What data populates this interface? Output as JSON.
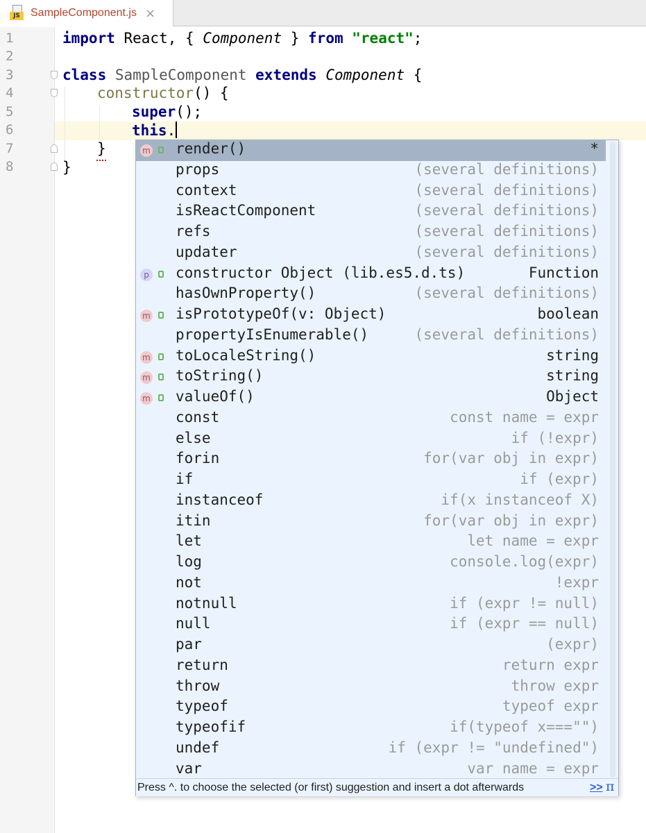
{
  "tab": {
    "icon_label": "JS",
    "title": "SampleComponent.js",
    "close": "×"
  },
  "line_numbers": [
    "1",
    "2",
    "3",
    "4",
    "5",
    "6",
    "7",
    "8"
  ],
  "code": {
    "l1": {
      "import": "import",
      "rest1": " React, { ",
      "component": "Component",
      "rest2": " } ",
      "from": "from",
      "space": " ",
      "str": "\"react\"",
      "semi": ";"
    },
    "l3": {
      "class": "class",
      "name": " SampleComponent ",
      "extends": "extends",
      "space": " ",
      "base": "Component",
      "brace": " {"
    },
    "l4": {
      "ctor": "constructor",
      "rest": "() {"
    },
    "l5": {
      "super": "super",
      "rest": "();"
    },
    "l6": {
      "this": "this",
      "dot": "."
    },
    "l7": {
      "brace": "}"
    },
    "l8": {
      "brace": "}"
    }
  },
  "completion": {
    "items": [
      {
        "icon": "m",
        "lock": true,
        "name": "render()",
        "type": "*",
        "gray": false,
        "selected": true
      },
      {
        "icon": "",
        "lock": false,
        "name": "props",
        "type": "(several definitions)",
        "gray": true
      },
      {
        "icon": "",
        "lock": false,
        "name": "context",
        "type": "(several definitions)",
        "gray": true
      },
      {
        "icon": "",
        "lock": false,
        "name": "isReactComponent",
        "type": "(several definitions)",
        "gray": true
      },
      {
        "icon": "",
        "lock": false,
        "name": "refs",
        "type": "(several definitions)",
        "gray": true
      },
      {
        "icon": "",
        "lock": false,
        "name": "updater",
        "type": "(several definitions)",
        "gray": true
      },
      {
        "icon": "p",
        "lock": true,
        "name": "constructor Object (lib.es5.d.ts)",
        "type": "Function",
        "gray": false
      },
      {
        "icon": "",
        "lock": false,
        "name": "hasOwnProperty()",
        "type": "(several definitions)",
        "gray": true
      },
      {
        "icon": "m",
        "lock": true,
        "name": "isPrototypeOf(v: Object)",
        "type": "boolean",
        "gray": false
      },
      {
        "icon": "",
        "lock": false,
        "name": "propertyIsEnumerable()",
        "type": "(several definitions)",
        "gray": true
      },
      {
        "icon": "m",
        "lock": true,
        "name": "toLocaleString()",
        "type": "string",
        "gray": false
      },
      {
        "icon": "m",
        "lock": true,
        "name": "toString()",
        "type": "string",
        "gray": false
      },
      {
        "icon": "m",
        "lock": true,
        "name": "valueOf()",
        "type": "Object",
        "gray": false
      },
      {
        "icon": "",
        "lock": false,
        "name": "const",
        "type": "const name = expr",
        "gray": true
      },
      {
        "icon": "",
        "lock": false,
        "name": "else",
        "type": "if (!expr)",
        "gray": true
      },
      {
        "icon": "",
        "lock": false,
        "name": "forin",
        "type": "for(var obj in expr)",
        "gray": true
      },
      {
        "icon": "",
        "lock": false,
        "name": "if",
        "type": "if (expr)",
        "gray": true
      },
      {
        "icon": "",
        "lock": false,
        "name": "instanceof",
        "type": "if(x instanceof X)",
        "gray": true
      },
      {
        "icon": "",
        "lock": false,
        "name": "itin",
        "type": "for(var obj in expr)",
        "gray": true
      },
      {
        "icon": "",
        "lock": false,
        "name": "let",
        "type": "let name = expr",
        "gray": true
      },
      {
        "icon": "",
        "lock": false,
        "name": "log",
        "type": "console.log(expr)",
        "gray": true
      },
      {
        "icon": "",
        "lock": false,
        "name": "not",
        "type": "!expr",
        "gray": true
      },
      {
        "icon": "",
        "lock": false,
        "name": "notnull",
        "type": "if (expr != null)",
        "gray": true
      },
      {
        "icon": "",
        "lock": false,
        "name": "null",
        "type": "if (expr == null)",
        "gray": true
      },
      {
        "icon": "",
        "lock": false,
        "name": "par",
        "type": "(expr)",
        "gray": true
      },
      {
        "icon": "",
        "lock": false,
        "name": "return",
        "type": "return expr",
        "gray": true
      },
      {
        "icon": "",
        "lock": false,
        "name": "throw",
        "type": "throw expr",
        "gray": true
      },
      {
        "icon": "",
        "lock": false,
        "name": "typeof",
        "type": "typeof expr",
        "gray": true
      },
      {
        "icon": "",
        "lock": false,
        "name": "typeofif",
        "type": "if(typeof x===\"\")",
        "gray": true
      },
      {
        "icon": "",
        "lock": false,
        "name": "undef",
        "type": "if (expr != \"undefined\")",
        "gray": true
      },
      {
        "icon": "",
        "lock": false,
        "name": "var",
        "type": "var name = expr",
        "gray": true
      }
    ],
    "footer": {
      "hint": "Press ^. to choose the selected (or first) suggestion and insert a dot afterwards",
      "more": ">>",
      "pi": "π"
    }
  }
}
